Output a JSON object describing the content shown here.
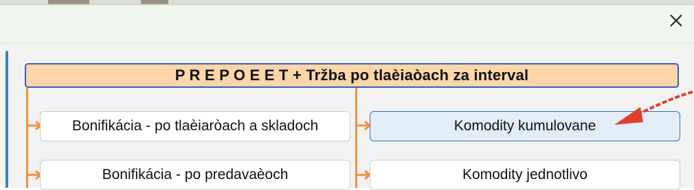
{
  "window": {
    "close_icon": "close-icon",
    "accent": "#2f63b8",
    "connector_color": "#f0913a",
    "header_bg": "#fcd6a8"
  },
  "header": {
    "title": "P R E P O E E T + Tržba po tlaèiaòach za interval"
  },
  "buttons": {
    "bonifikacia_tlaciarne": "Bonifikácia - po tlaèiaròach a skladoch",
    "komodity_kumulovane": "Komodity kumulovane",
    "bonifikacia_predavace": "Bonifikácia - po predavaèoch",
    "komodity_jednotlivo": "Komodity jednotlivo"
  },
  "annotation": {
    "icon": "red-arrow-icon",
    "color": "#e0402a"
  }
}
